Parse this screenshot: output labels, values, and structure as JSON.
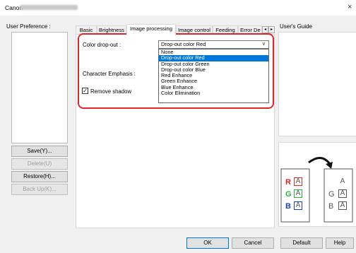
{
  "window": {
    "title": "Canon",
    "close_glyph": "×"
  },
  "left": {
    "label": "User Preference :",
    "buttons": [
      {
        "label": "Save(Y)...",
        "enabled": true
      },
      {
        "label": "Delete(U)",
        "enabled": false
      },
      {
        "label": "Restore(H)...",
        "enabled": true
      },
      {
        "label": "Back Up(K)...",
        "enabled": false
      }
    ]
  },
  "tabs": [
    "Basic",
    "Brightness",
    "Image processing",
    "Image control",
    "Feeding",
    "Error De"
  ],
  "active_tab": "Image processing",
  "tab_scroll": {
    "left": "◂",
    "right": "▸"
  },
  "color_dropout": {
    "label": "Color drop-out :",
    "value": "Drop-out color Red",
    "arrow": "∨",
    "options": [
      "None",
      "Drop-out color Red",
      "Drop-out color Green",
      "Drop-out color Blue",
      "Red Enhance",
      "Green Enhance",
      "Blue Enhance",
      "Color Elimination"
    ],
    "selected_index": 1
  },
  "character_emphasis": {
    "label": "Character Emphasis :"
  },
  "remove_shadow": {
    "label": "Remove shadow",
    "checked": true,
    "check_glyph": "✓"
  },
  "guide": {
    "label": "User's Guide"
  },
  "illustration": {
    "left_letters": [
      {
        "plain": "R",
        "boxed": "A",
        "color": "#e8202a"
      },
      {
        "plain": "G",
        "boxed": "A",
        "color": "#2bb53a"
      },
      {
        "plain": "B",
        "boxed": "A",
        "color": "#1d3fc4"
      }
    ],
    "right_letters": [
      {
        "plain": "",
        "boxed": "A"
      },
      {
        "plain": "G",
        "boxed": "A"
      },
      {
        "plain": "B",
        "boxed": "A"
      }
    ]
  },
  "footer": {
    "ok": "OK",
    "cancel": "Cancel",
    "default": "Default",
    "help": "Help"
  },
  "colors": {
    "accent": "#0078d7",
    "highlight": "#e0262a"
  }
}
